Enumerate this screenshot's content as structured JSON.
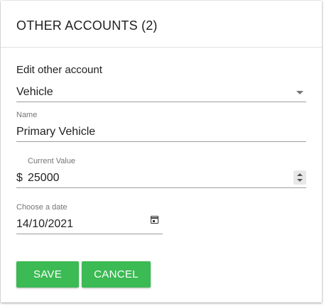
{
  "dialog": {
    "title": "OTHER ACCOUNTS (2)",
    "section_label": "Edit other account"
  },
  "form": {
    "account_type": {
      "value": "Vehicle"
    },
    "name": {
      "label": "Name",
      "value": "Primary Vehicle"
    },
    "current_value": {
      "label": "Current Value",
      "currency": "$",
      "value": "25000"
    },
    "date": {
      "label": "Choose a date",
      "value": "14/10/2021"
    }
  },
  "actions": {
    "save_label": "SAVE",
    "cancel_label": "CANCEL"
  },
  "colors": {
    "button_green": "#3cba54"
  },
  "icons": {
    "select_caret": "chevron-down-icon",
    "spinner": "number-spinner-icon",
    "date": "calendar-icon"
  }
}
